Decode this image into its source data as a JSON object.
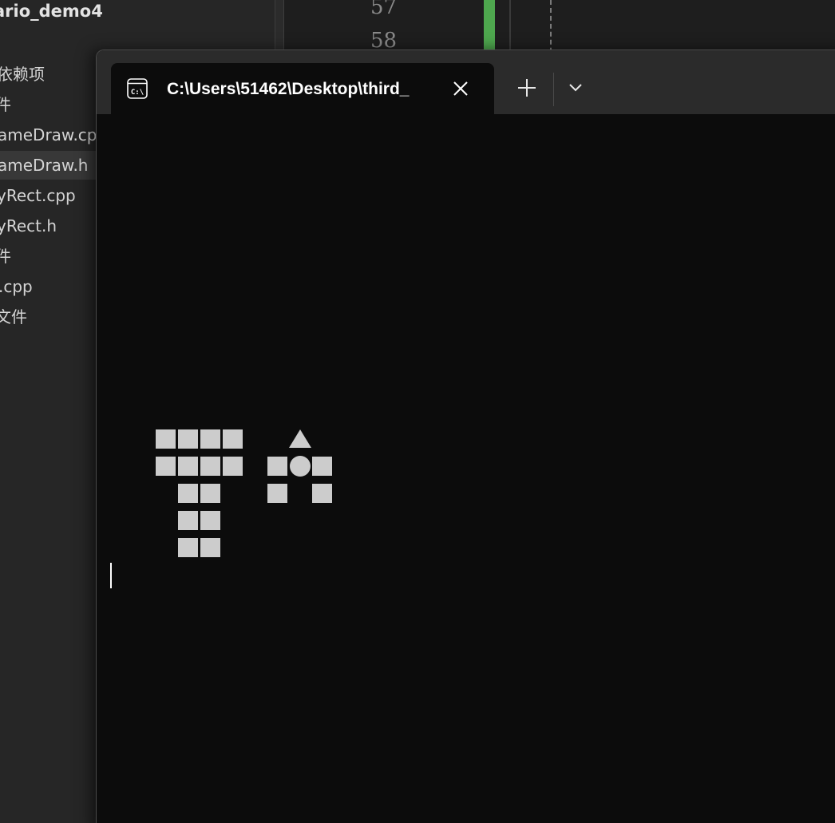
{
  "ide": {
    "project_title": "ario_demo4",
    "tree_items": [
      "依赖项",
      "件",
      "ameDraw.cp",
      "ameDraw.h",
      "yRect.cpp",
      "yRect.h",
      "件",
      ".cpp",
      "文件"
    ],
    "selected_index": 3,
    "line_numbers": [
      "57",
      "58"
    ],
    "change_margin_color": "#4ea74e"
  },
  "terminal": {
    "tab": {
      "title": "C:\\Users\\51462\\Desktop\\third_",
      "icon": "terminal-icon",
      "icon_text": "C:\\"
    },
    "icons": {
      "close": "close-icon",
      "new_tab": "plus-icon",
      "dropdown": "chevron-down-icon"
    },
    "background_color": "#0c0c0c",
    "glyph_color": "#cccccc",
    "output_glyphs": {
      "row1": "■■■■  ▲",
      "row2": "■■■■ ■●■",
      "row3": " ■■  ■ ■",
      "row4": " ■■",
      "row5": " ■■"
    }
  }
}
